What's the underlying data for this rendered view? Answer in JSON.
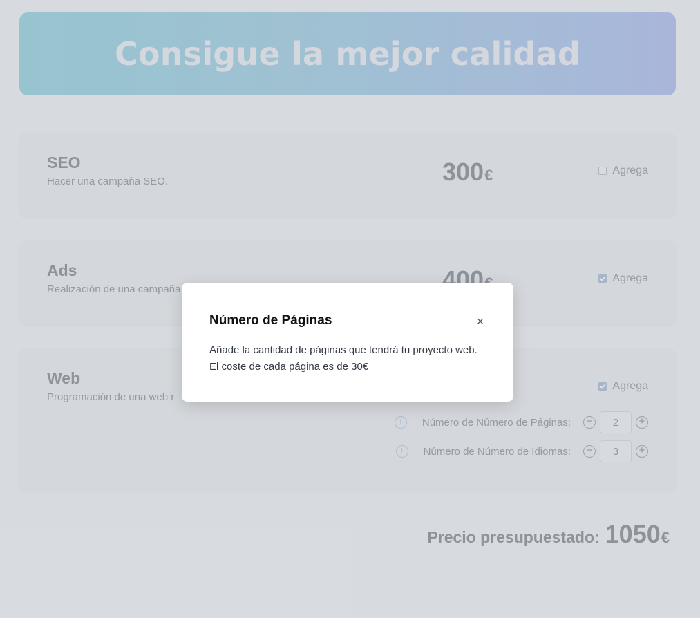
{
  "hero": {
    "title": "Consigue la mejor calidad"
  },
  "services": [
    {
      "name": "SEO",
      "description": "Hacer una campaña SEO.",
      "price": "300",
      "currency": "€",
      "add_label": "Agrega",
      "checked": false
    },
    {
      "name": "Ads",
      "description": "Realización de una campaña",
      "price": "400",
      "currency": "€",
      "add_label": "Agrega",
      "checked": true
    },
    {
      "name": "Web",
      "description": "Programación de una web r",
      "price": "",
      "currency": "",
      "add_label": "Agrega",
      "checked": true
    }
  ],
  "web_options": [
    {
      "info_icon": "i",
      "label": "Número de Número de Páginas:",
      "value": "2"
    },
    {
      "info_icon": "i",
      "label": "Número de Número de Idiomas:",
      "value": "3"
    }
  ],
  "stepper": {
    "minus": "−",
    "plus": "+"
  },
  "total": {
    "label": "Precio presupuestado:",
    "value": "1050",
    "currency": "€"
  },
  "modal": {
    "title": "Número de Páginas",
    "close": "×",
    "body": "Añade la cantidad de páginas que tendrá tu proyecto web. El coste de cada página es de 30€"
  },
  "colors": {
    "accent_start": "#a9dbe6",
    "accent_end": "#bdcbf2",
    "overlay": "rgba(40,48,60,0.13)"
  }
}
